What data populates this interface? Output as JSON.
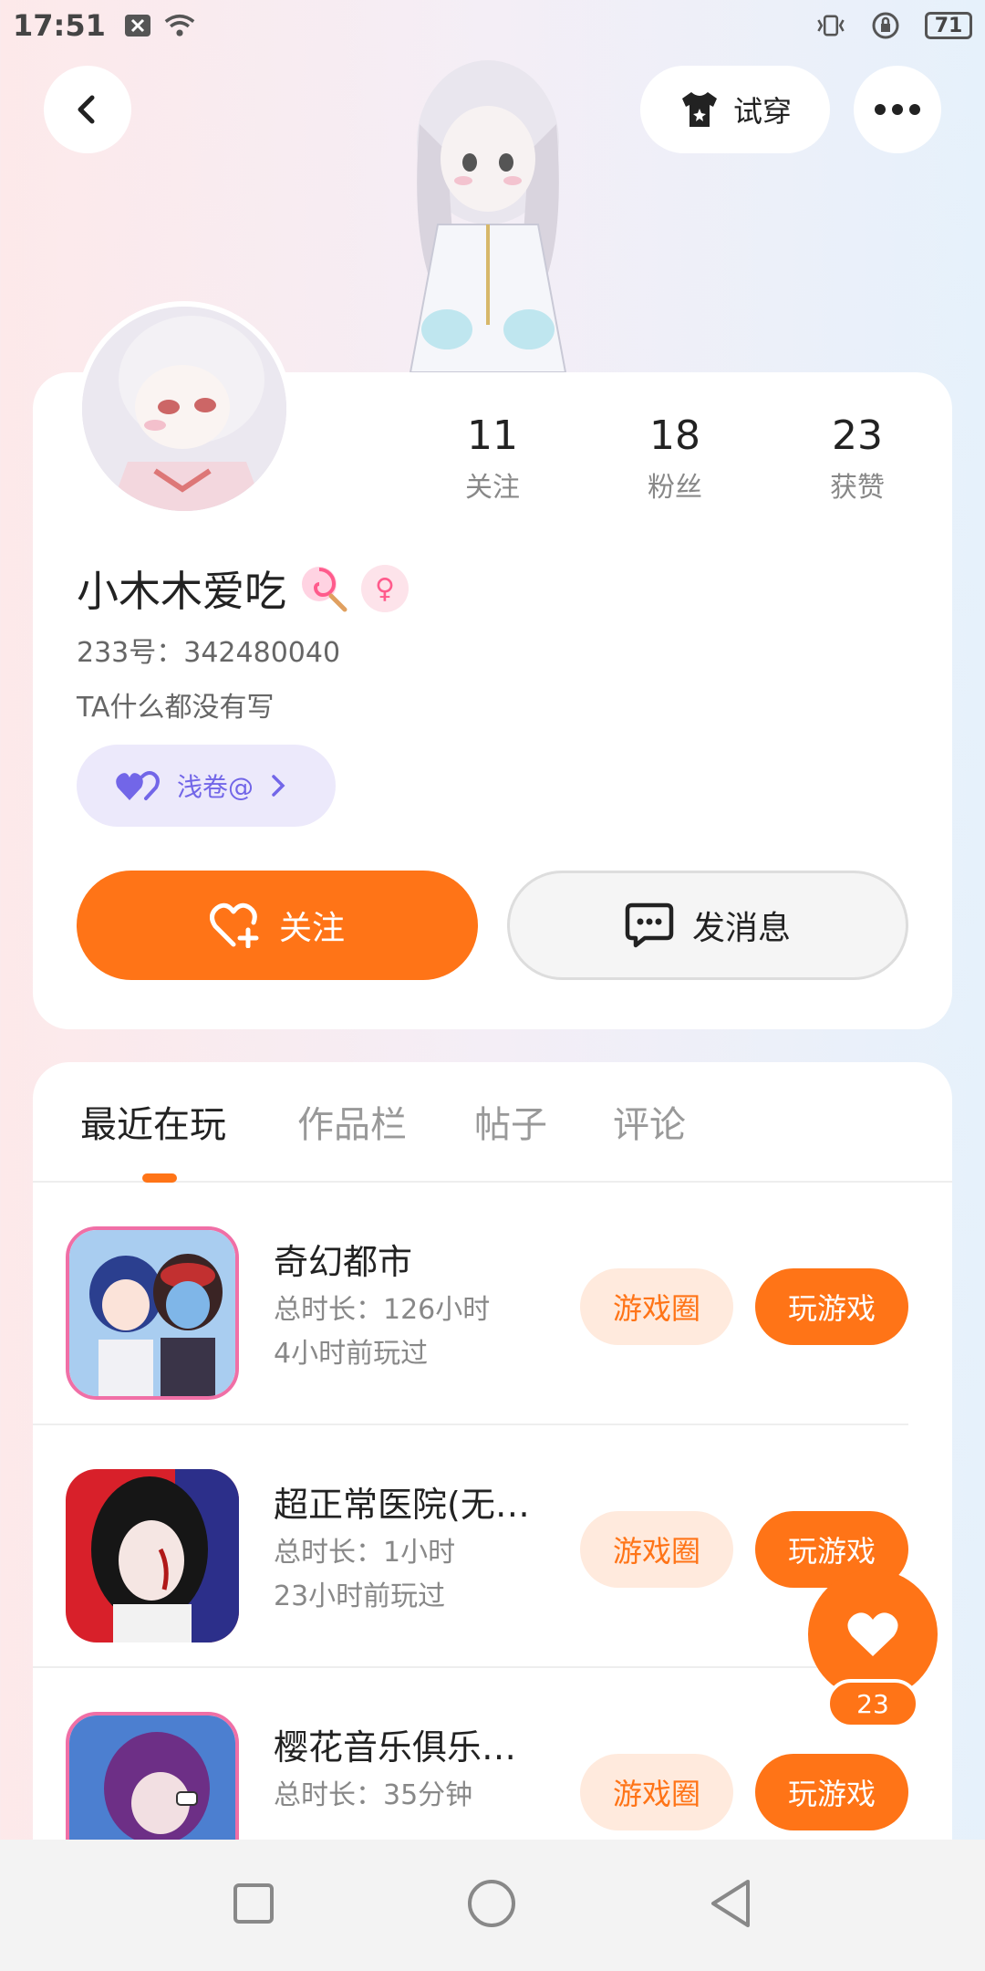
{
  "status_bar": {
    "time": "17:51",
    "battery": "71"
  },
  "header": {
    "try_on_label": "试穿"
  },
  "profile": {
    "stats": [
      {
        "value": "11",
        "label": "关注"
      },
      {
        "value": "18",
        "label": "粉丝"
      },
      {
        "value": "23",
        "label": "获赞"
      }
    ],
    "username": "小木木爱吃",
    "gender_symbol": "♀",
    "uid_line": "233号：342480040",
    "bio": "TA什么都没有写",
    "tag_label": "浅卷@",
    "follow_label": "关注",
    "message_label": "发消息"
  },
  "tabs": [
    "最近在玩",
    "作品栏",
    "帖子",
    "评论"
  ],
  "games": [
    {
      "title": "奇幻都市",
      "duration": "总时长：126小时",
      "last_played": "4小时前玩过",
      "circle_label": "游戏圈",
      "play_label": "玩游戏"
    },
    {
      "title": "超正常医院(无…",
      "duration": "总时长：1小时",
      "last_played": "23小时前玩过",
      "circle_label": "游戏圈",
      "play_label": "玩游戏"
    },
    {
      "title": "樱花音乐俱乐…",
      "duration": "总时长：35分钟",
      "last_played": "",
      "circle_label": "游戏圈",
      "play_label": "玩游戏"
    }
  ],
  "floating_like": {
    "count": "23"
  },
  "colors": {
    "accent": "#ff7417",
    "accent_light": "#ffeadd",
    "purple": "#7266e8"
  }
}
